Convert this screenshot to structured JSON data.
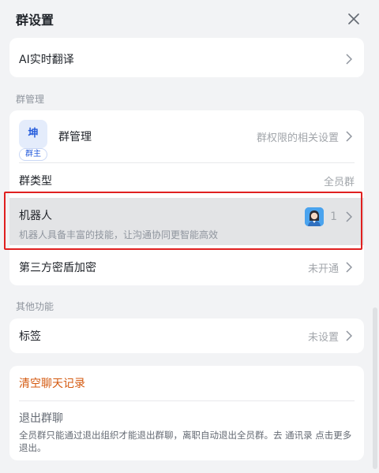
{
  "header": {
    "title": "群设置",
    "close_icon": "close-icon"
  },
  "translate": {
    "label": "AI实时翻译"
  },
  "sections": {
    "group_management": "群管理",
    "other_features": "其他功能"
  },
  "group": {
    "avatar_char": "坤",
    "owner_badge": "群主",
    "label": "群管理",
    "value": "群权限的相关设置"
  },
  "group_type": {
    "label": "群类型",
    "value": "全员群"
  },
  "robot": {
    "label": "机器人",
    "description": "机器人具备丰富的技能，让沟通协同更智能高效",
    "count": "1"
  },
  "encryption": {
    "label": "第三方密盾加密",
    "value": "未开通"
  },
  "tags": {
    "label": "标签",
    "value": "未设置"
  },
  "clear_history": {
    "label": "清空聊天记录",
    "color": "#d45a10"
  },
  "exit": {
    "title": "退出群聊",
    "description": "全员群只能通过退出组织才能退出群聊，离职自动退出全员群。去 通讯录 点击更多退出。"
  },
  "colors": {
    "highlight": "#e02020",
    "accent": "#245bdb"
  }
}
